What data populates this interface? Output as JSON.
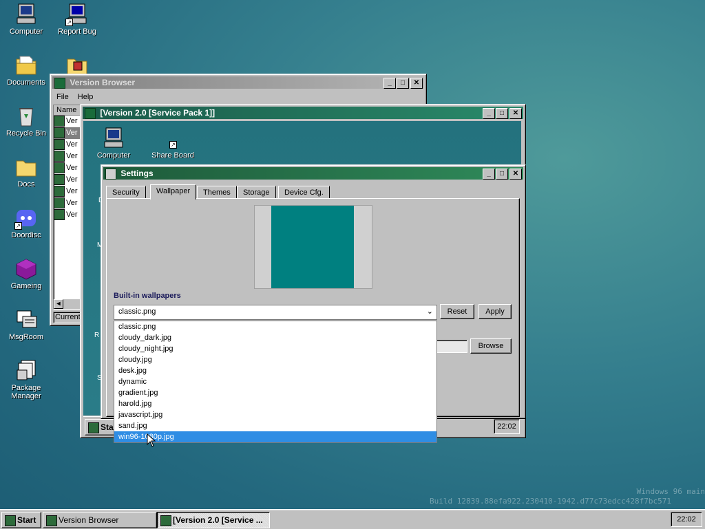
{
  "desktop": {
    "icons": [
      {
        "label": "Computer"
      },
      {
        "label": "Report Bug"
      },
      {
        "label": "Documents"
      },
      {
        "label": "Recycle Bin"
      },
      {
        "label": "Docs"
      },
      {
        "label": "Doordisc"
      },
      {
        "label": "Gameing"
      },
      {
        "label": "MsgRoom"
      },
      {
        "label": "Package Manager"
      }
    ],
    "watermark_line1": "Windows 96 main",
    "watermark_line2": "Build 12839.88efa922.230410-1942.d77c73edcc428f7bc571"
  },
  "version_browser": {
    "title": "Version Browser",
    "menu": [
      "File",
      "Help"
    ],
    "column_header": "Name",
    "rows": [
      "Ver",
      "Ver",
      "Ver",
      "Ver",
      "Ver",
      "Ver",
      "Ver",
      "Ver",
      "Ver"
    ],
    "status": "Current '"
  },
  "sp_window": {
    "title": "[Version 2.0 [Service Pack 1]]",
    "icons": [
      {
        "label": "Computer"
      },
      {
        "label": "Share Board"
      }
    ],
    "side_letters": [
      "D",
      "M",
      "R",
      "S"
    ],
    "taskbar_start": "Sta",
    "clock": "22:02"
  },
  "settings": {
    "title": "Settings",
    "tabs": [
      "Security",
      "Wallpaper",
      "Themes",
      "Storage",
      "Device Cfg."
    ],
    "selected_tab": "Wallpaper",
    "preview_color": "#008080",
    "builtin_label": "Built-in wallpapers",
    "selected_value": "classic.png",
    "reset_label": "Reset",
    "apply_label": "Apply",
    "browse_label": "Browse",
    "options": [
      "classic.png",
      "cloudy_dark.jpg",
      "cloudy_night.jpg",
      "cloudy.jpg",
      "desk.jpg",
      "dynamic",
      "gradient.jpg",
      "harold.jpg",
      "javascript.jpg",
      "sand.jpg",
      "win96-1080p.jpg"
    ],
    "highlighted_option": "win96-1080p.jpg"
  },
  "taskbar": {
    "start_label": "Start",
    "items": [
      {
        "label": "Version Browser"
      },
      {
        "label": "[Version 2.0 [Service ..."
      }
    ],
    "clock": "22:02"
  }
}
